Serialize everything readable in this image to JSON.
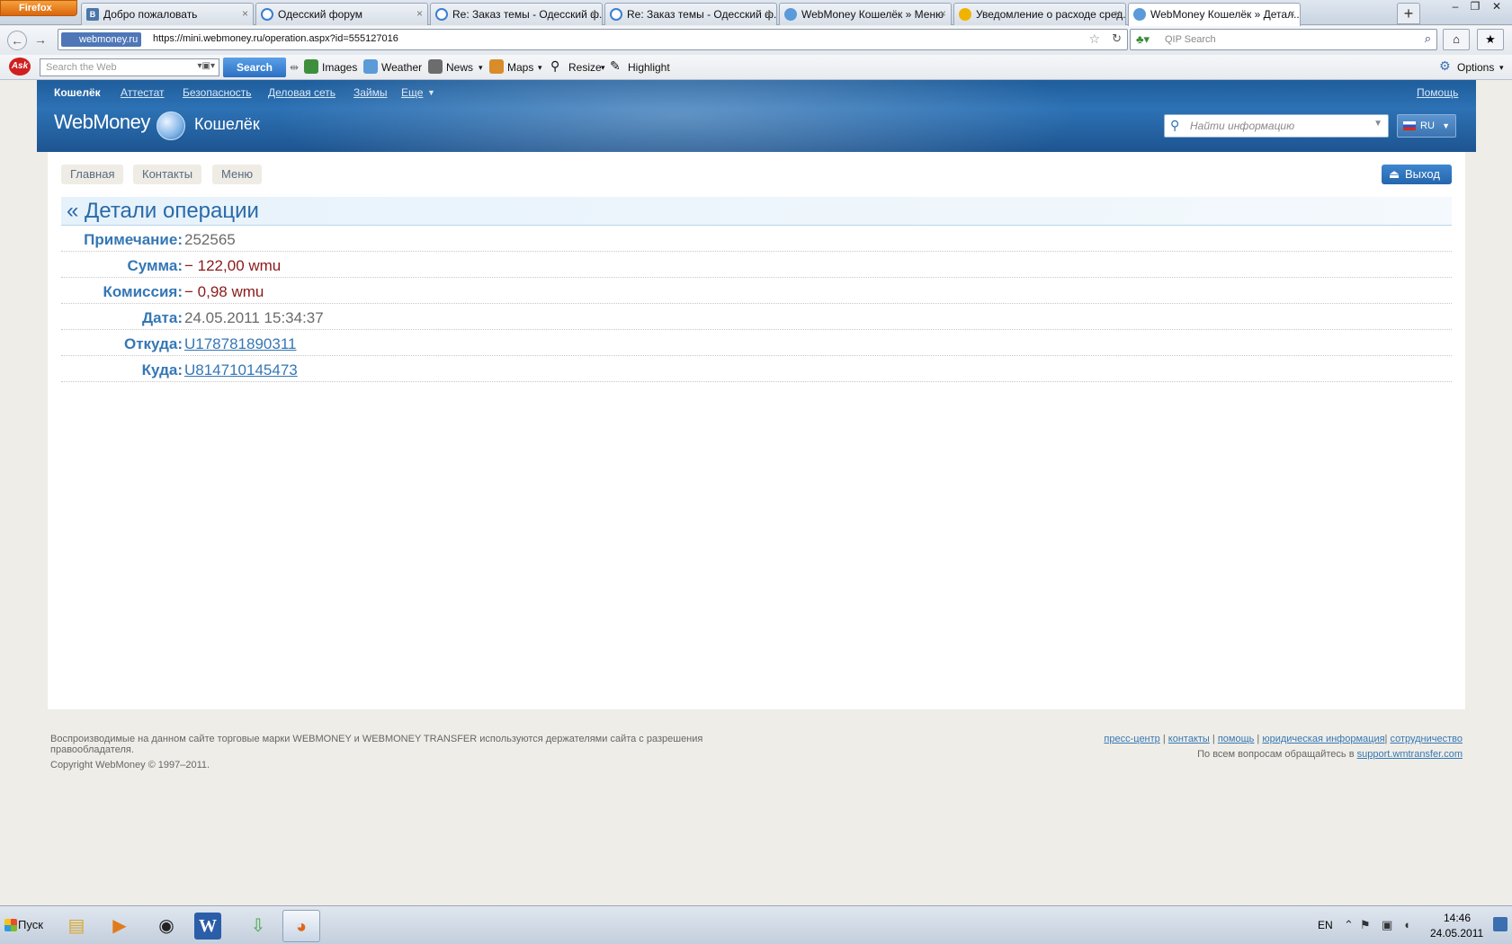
{
  "browser": {
    "menu_label": "Firefox",
    "tabs": [
      {
        "title": "Добро пожаловать",
        "icon": "vk-favicon"
      },
      {
        "title": "Одесский форум",
        "icon": "forum-favicon"
      },
      {
        "title": "Re: Заказ темы - Одесский ф...",
        "icon": "forum-favicon"
      },
      {
        "title": "Re: Заказ темы - Одесский ф...",
        "icon": "forum-favicon"
      },
      {
        "title": "WebMoney Кошелёк » Меню",
        "icon": "webmoney-favicon"
      },
      {
        "title": "Уведомление о расходе сред...",
        "icon": "notice-favicon"
      },
      {
        "title": "WebMoney Кошелёк » Детал...",
        "icon": "webmoney-favicon"
      }
    ],
    "new_tab_label": "+",
    "url_site": "webmoney.ru",
    "url": "https://mini.webmoney.ru/operation.aspx?id=555127016",
    "qip_placeholder": "QIP Search"
  },
  "ask_toolbar": {
    "search_placeholder": "Search the Web",
    "search_button": "Search",
    "links": [
      "Images",
      "Weather",
      "News",
      "Maps",
      "Resize",
      "Highlight"
    ],
    "options_label": "Options"
  },
  "wm": {
    "topnav": [
      "Кошелёк",
      "Аттестат",
      "Безопасность",
      "Деловая сеть",
      "Займы",
      "Еще"
    ],
    "help": "Помощь",
    "logo": "WebMoney",
    "product": "Кошелёк",
    "search_placeholder": "Найти информацию",
    "lang": "RU",
    "pills": [
      "Главная",
      "Контакты",
      "Меню"
    ],
    "logout": "Выход",
    "page_title": "« Детали операции",
    "details": [
      {
        "label": "Примечание:",
        "value": "252565",
        "kind": "plain"
      },
      {
        "label": "Сумма:",
        "value": "− 122,00 wmu",
        "kind": "neg"
      },
      {
        "label": "Комиссия:",
        "value": "− 0,98 wmu",
        "kind": "neg"
      },
      {
        "label": "Дата:",
        "value": "24.05.2011 15:34:37",
        "kind": "plain"
      },
      {
        "label": "Откуда:",
        "value": "U178781890311",
        "kind": "link"
      },
      {
        "label": "Куда:",
        "value": "U814710145473",
        "kind": "link"
      }
    ],
    "footer": {
      "note": "Воспроизводимые на данном сайте торговые марки WEBMONEY и WEBMONEY TRANSFER используются держателями сайта с разрешения правообладателя.",
      "copyright": "Copyright WebMoney © 1997–2011.",
      "links": [
        "пресс-центр",
        "контакты",
        "помощь",
        "юридическая информация",
        "сотрудничество"
      ],
      "support_text": "По всем вопросам обращайтесь в",
      "support_link": "support.wmtransfer.com"
    }
  },
  "taskbar": {
    "start": "Пуск",
    "lang": "EN",
    "time": "14:46",
    "date": "24.05.2011"
  }
}
